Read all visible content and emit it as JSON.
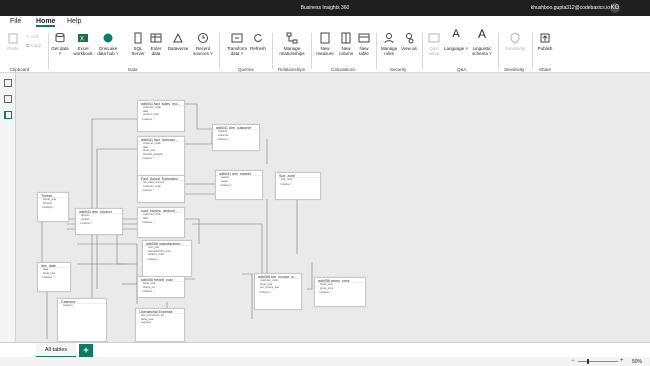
{
  "window": {
    "title": "Business Insights 360",
    "user": "khushboo.gupta312@codebasics.io",
    "avatar": "KG"
  },
  "menu": {
    "file": "File",
    "home": "Home",
    "help": "Help"
  },
  "ribbon": {
    "paste": "Paste",
    "cut": "Cut",
    "copy": "Copy",
    "get_data": "Get data ˅",
    "excel_workbook": "Excel workbook",
    "onelake": "OneLake data hub ˅",
    "sql_server": "SQL Server",
    "enter_data": "Enter data",
    "dataverse": "Dataverse",
    "recent_sources": "Recent sources ˅",
    "transform_data": "Transform data ˅",
    "refresh": "Refresh",
    "manage_relationships": "Manage relationships",
    "new_measure": "New measure",
    "new_column": "New column",
    "new_table": "New table",
    "manage_roles": "Manage roles",
    "view_as": "View as",
    "qa_setup": "Q&A setup",
    "language": "Language ˅",
    "linguistic_schema": "Linguistic schema ˅",
    "sensitivity": "Sensitivity",
    "publish": "Publish",
    "groups": {
      "clipboard": "Clipboard",
      "data": "Data",
      "queries": "Queries",
      "relationships": "Relationships",
      "calculations": "Calculations",
      "security": "Security",
      "qa": "Q&A",
      "sensitivity": "Sensitivity",
      "share": "Share"
    }
  },
  "left_icons": [
    "report-view-icon",
    "table-view-icon",
    "model-view-icon"
  ],
  "tables": [
    {
      "name": "gdb041 fact_sales_mo...",
      "fields": [
        "customer_code",
        "date",
        "product_code",
        "Collapse ˄"
      ]
    },
    {
      "name": "gdb041 fact_forecast...",
      "fields": [
        "customer_code",
        "date",
        "fiscal_year",
        "forecast_quantity",
        "Collapse ˄"
      ]
    },
    {
      "name": "gdb041 dim_customer",
      "fields": [
        "channel",
        "customer",
        "Collapse ˄"
      ]
    },
    {
      "name": "Fact_Actual_Estimates",
      "fields": [
        "net_sales_amount",
        "customer_code",
        "Collapse ˄"
      ]
    },
    {
      "name": "gdb041 dim_market",
      "fields": [
        "market",
        "region",
        "Collapse ˄"
      ]
    },
    {
      "name": "Sub_zone",
      "fields": [
        "sub_zone",
        "Collapse ˄"
      ]
    },
    {
      "name": "post_invoice_deducti...",
      "fields": [
        "customer_code",
        "date",
        "Collapse ˄"
      ]
    },
    {
      "name": "Thresh...",
      "fields": [
        "Fiscal_year",
        "Product",
        "Collapse ˄"
      ]
    },
    {
      "name": "gdb041 dim_product",
      "fields": [
        "division",
        "product",
        "Collapse ˄"
      ]
    },
    {
      "name": "gdb056 manufacturin...",
      "fields": [
        "cost_year",
        "manufacturing_cost",
        "product_code",
        "Collapse ˄"
      ]
    },
    {
      "name": "dim_date",
      "fields": [
        "date",
        "fiscal_year",
        "Collapse ˄"
      ]
    },
    {
      "name": "gdb056 freight_cost",
      "fields": [
        "fiscal_year",
        "freight_pct",
        "Collapse ˄"
      ]
    },
    {
      "name": "gdb056 pre_invoice_d...",
      "fields": [
        "customer_code",
        "fiscal_year",
        "pre_invoice_disc",
        "Collapse ˄"
      ]
    },
    {
      "name": "gdb056 gross_price",
      "fields": [
        "fiscal_year",
        "gross_price",
        "Collapse ˄"
      ]
    },
    {
      "name": "Category",
      "fields": [
        "category"
      ]
    },
    {
      "name": "Operational Expense",
      "fields": [
        "ads_promotions_pct",
        "fiscal_year",
        "segment"
      ]
    }
  ],
  "tab": {
    "all_tables": "All tables",
    "add": "+"
  },
  "status": {
    "zoom": "50%"
  }
}
